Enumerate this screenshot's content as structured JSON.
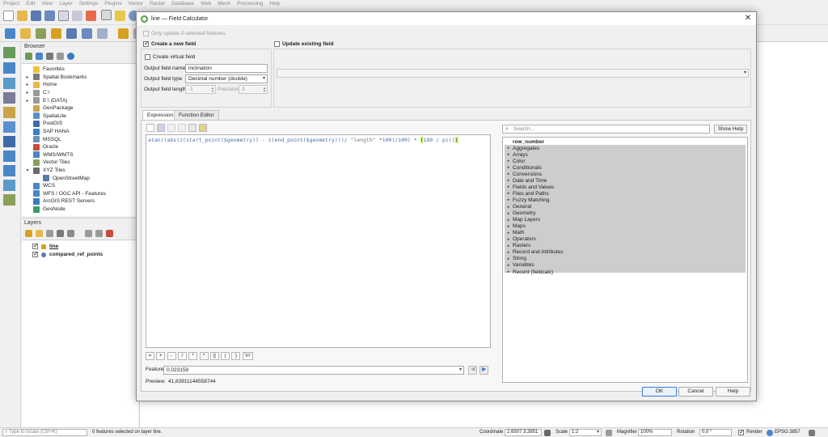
{
  "menubar": [
    "Project",
    "Edit",
    "View",
    "Layer",
    "Settings",
    "Plugins",
    "Vector",
    "Raster",
    "Database",
    "Web",
    "Mesh",
    "Processing",
    "Help"
  ],
  "browser": {
    "title": "Browser",
    "items": [
      {
        "label": "Favorites",
        "arrow": "",
        "icon": "star-icon",
        "color": "#f2c230"
      },
      {
        "label": "Spatial Bookmarks",
        "arrow": "▸",
        "icon": "bookmark-icon",
        "color": "#7a7a7a"
      },
      {
        "label": "Home",
        "arrow": "▸",
        "icon": "folder-icon",
        "color": "#e6b84a"
      },
      {
        "label": "C:\\",
        "arrow": "▸",
        "icon": "drive-icon",
        "color": "#9a9a9a"
      },
      {
        "label": "E:\\ (DATA)",
        "arrow": "▸",
        "icon": "drive-icon",
        "color": "#9a9a9a"
      },
      {
        "label": "GeoPackage",
        "arrow": "",
        "icon": "geopackage-icon",
        "color": "#c9a44a"
      },
      {
        "label": "SpatiaLite",
        "arrow": "",
        "icon": "spatialite-icon",
        "color": "#5a8fd0"
      },
      {
        "label": "PostGIS",
        "arrow": "",
        "icon": "postgis-icon",
        "color": "#3f6aa8"
      },
      {
        "label": "SAP HANA",
        "arrow": "",
        "icon": "sap-hana-icon",
        "color": "#3e7dc7"
      },
      {
        "label": "MSSQL",
        "arrow": "",
        "icon": "mssql-icon",
        "color": "#6c8fbf"
      },
      {
        "label": "Oracle",
        "arrow": "",
        "icon": "oracle-icon",
        "color": "#c94a3a"
      },
      {
        "label": "WMS/WMTS",
        "arrow": "",
        "icon": "wms-icon",
        "color": "#4a86c8"
      },
      {
        "label": "Vector Tiles",
        "arrow": "",
        "icon": "vector-tiles-icon",
        "color": "#8aa05a"
      },
      {
        "label": "XYZ Tiles",
        "arrow": "▾",
        "icon": "xyz-tiles-icon",
        "color": "#6a6a6a"
      },
      {
        "label": "OpenStreetMap",
        "arrow": "",
        "icon": "tile-icon",
        "color": "#5a7aa8",
        "indent": 1
      },
      {
        "label": "WCS",
        "arrow": "",
        "icon": "wcs-icon",
        "color": "#4a86c8"
      },
      {
        "label": "WFS / OGC API - Features",
        "arrow": "",
        "icon": "wfs-icon",
        "color": "#4a86c8"
      },
      {
        "label": "ArcGIS REST Servers",
        "arrow": "",
        "icon": "arcgis-icon",
        "color": "#3a7ac0"
      },
      {
        "label": "GeoNode",
        "arrow": "",
        "icon": "geonode-icon",
        "color": "#3a9a6a"
      }
    ]
  },
  "layers": {
    "title": "Layers",
    "items": [
      {
        "label": "line",
        "checked": true,
        "icon": "line-layer-icon",
        "color": "#d8a020"
      },
      {
        "label": "compared_ref_points",
        "checked": true,
        "icon": "point-layer-icon",
        "color": "#5a7ab0"
      }
    ]
  },
  "dialog": {
    "title": "line — Field Calculator",
    "only_update_label": "Only update 0 selected features",
    "create_new_field_label": "Create a new field",
    "create_virtual_label": "Create virtual field",
    "output_name_label": "Output field name",
    "output_name_value": "inclination",
    "output_type_label": "Output field type",
    "output_type_value": "Decimal number (double)",
    "output_length_label": "Output field length",
    "output_length_value": "-1",
    "precision_label": "Precision",
    "precision_value": "3",
    "update_existing_label": "Update existing field",
    "tabs": [
      "Expression",
      "Function Editor"
    ],
    "expression_parts": {
      "a": "atan((abs(z(start_point($geometry)) - z(end_point($geometry)))/ ",
      "str": "\"length\"",
      "b": " *100)/100) * ",
      "hl1": "(",
      "c": "180 / pi()",
      "hl2": ")"
    },
    "operators": [
      "=",
      "+",
      "-",
      "/",
      "*",
      "^",
      "||",
      "(",
      ")",
      "'\\n'"
    ],
    "feature_label": "Feature",
    "feature_value": "0.023159",
    "preview_label": "Preview:",
    "preview_value": "41,83911144558744",
    "search_placeholder": "Search...",
    "show_help_label": "Show Help",
    "functions": [
      "row_number",
      "Aggregates",
      "Arrays",
      "Color",
      "Conditionals",
      "Conversions",
      "Date and Time",
      "Fields and Values",
      "Files and Paths",
      "Fuzzy Matching",
      "General",
      "Geometry",
      "Map Layers",
      "Maps",
      "Math",
      "Operators",
      "Rasters",
      "Record and Attributes",
      "String",
      "Variables",
      "Recent (fieldcalc)"
    ],
    "ok_label": "OK",
    "cancel_label": "Cancel",
    "help_label": "Help"
  },
  "statusbar": {
    "locate_placeholder": "Type to locate (Ctrl+K)",
    "selection_msg": "0 features selected on layer line.",
    "coordinate_label": "Coordinate",
    "coordinate_value": "2,6507 3,3851",
    "scale_label": "Scale",
    "scale_value": "1:2",
    "magnifier_label": "Magnifier",
    "magnifier_value": "100%",
    "rotation_label": "Rotation",
    "rotation_value": "0,0 °",
    "render_label": "Render",
    "crs_label": "EPSG:3857"
  },
  "colors": {
    "accent": "#3a7bd5",
    "highlight": "#c8f26a",
    "qgis_green": "#49a43d",
    "list_bg": "#cdcdcd"
  }
}
